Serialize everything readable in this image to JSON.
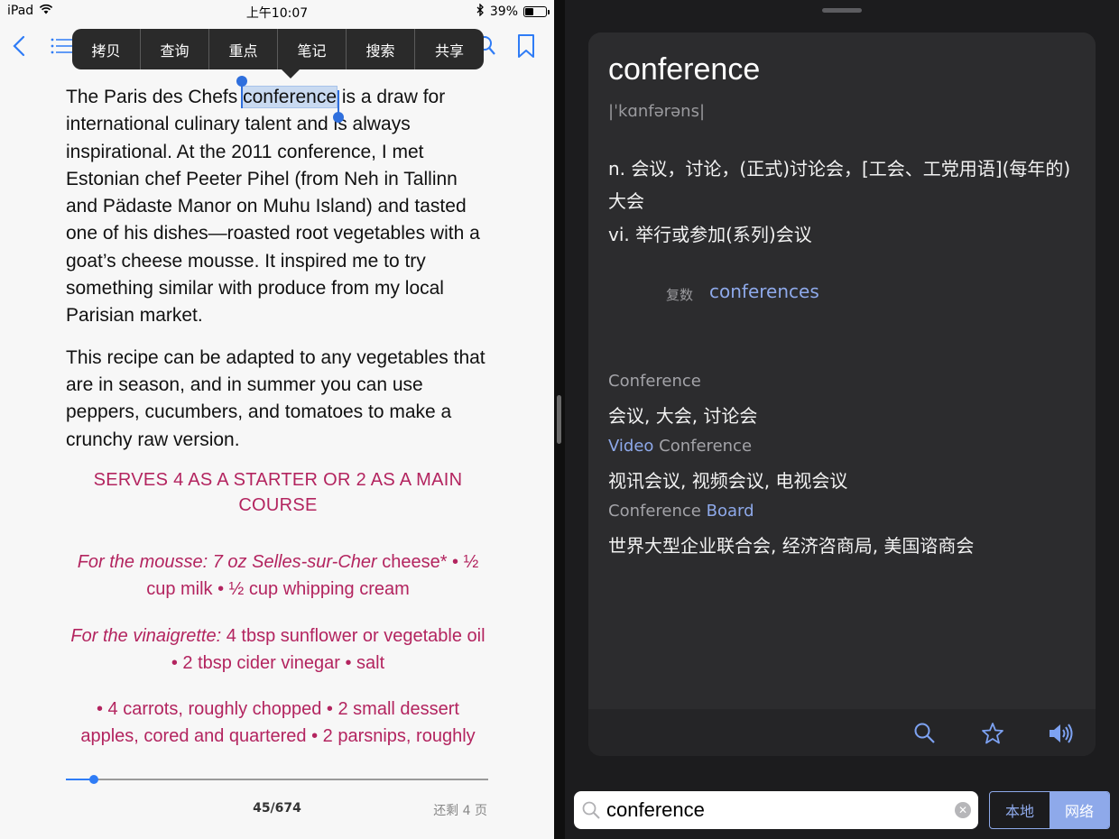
{
  "status_bar": {
    "device": "iPad",
    "time": "上午10:07",
    "battery": "39%",
    "battery_level": 0.39
  },
  "reader": {
    "popup_menu": [
      "拷贝",
      "查询",
      "重点",
      "笔记",
      "搜索",
      "共享"
    ],
    "para1_before": "The Paris des Chefs ",
    "para1_selected": "conference",
    "para1_after": " is a draw for international culinary talent and is always inspirational. At the 2011 conference, I met Estonian chef Peeter Pihel (from Neh in Tallinn and Pädaste Manor on Muhu Island) and tasted one of his dishes—roasted root vegetables with a goat’s cheese mousse. It inspired me to try something similar with produce from my local Parisian market.",
    "para2": "This recipe can be adapted to any vegetables that are in season, and in summer you can use peppers, cucumbers, and tomatoes to make a crunchy raw version.",
    "serves": "SERVES 4 AS A STARTER OR 2 AS A MAIN COURSE",
    "ing1_italic": "For the mousse: 7 oz Selles-sur-Cher",
    "ing1_rest": " cheese* • ½ cup milk • ½ cup whipping cream",
    "ing2_italic": "For the vinaigrette:",
    "ing2_rest": " 4 tbsp sunflower or vegetable oil • 2 tbsp cider vinegar • salt",
    "ing3": "• 4 carrots, roughly chopped • 2 small dessert apples, cored and quartered • 2 parsnips, roughly",
    "page": "45/674",
    "remaining": "还剩 4 页",
    "progress": 0.067
  },
  "dictionary": {
    "word": "conference",
    "phonetic": "|ˈkɑnfərəns|",
    "def_noun": "n. 会议，讨论，(正式)讨论会，[工会、工党用语](每年的)大会",
    "def_verb": "vi. 举行或参加(系列)会议",
    "plural_label": "复数",
    "plural_value": "conferences",
    "phrases": [
      {
        "link": "",
        "text": "Conference",
        "translation": "会议, 大会, 讨论会"
      },
      {
        "link": "Video",
        "text": " Conference",
        "translation": "视讯会议, 视频会议, 电视会议"
      },
      {
        "link": "",
        "text": "Conference ",
        "link2": "Board",
        "translation": "世界大型企业联合会, 经济咨商局, 美国谘商会"
      }
    ],
    "search_value": "conference",
    "segment": [
      "本地",
      "网络"
    ],
    "segment_selected": "网络"
  }
}
